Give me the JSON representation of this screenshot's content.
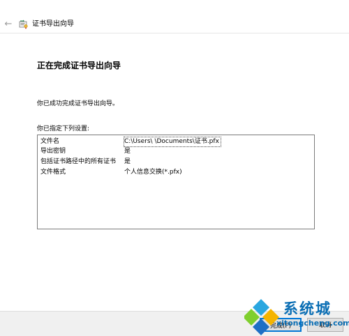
{
  "window": {
    "title": "证书导出向导",
    "back_icon": "←"
  },
  "page": {
    "heading": "正在完成证书导出向导",
    "success_message": "你已成功完成证书导出向导。",
    "settings_label": "你已指定下列设置:"
  },
  "settings": [
    {
      "key": "文件名",
      "value": "C:\\Users\\        \\Documents\\证书.pfx"
    },
    {
      "key": "导出密钥",
      "value": "是"
    },
    {
      "key": "包括证书路径中的所有证书",
      "value": "是"
    },
    {
      "key": "文件格式",
      "value": "个人信息交换(*.pfx)"
    }
  ],
  "buttons": {
    "finish": "完成(F)",
    "cancel": "取消"
  },
  "watermark": {
    "brand": "系统城",
    "url": "xitongcheng.com"
  },
  "colors": {
    "accent": "#0078d7",
    "watermark": "#0a6eb4"
  }
}
